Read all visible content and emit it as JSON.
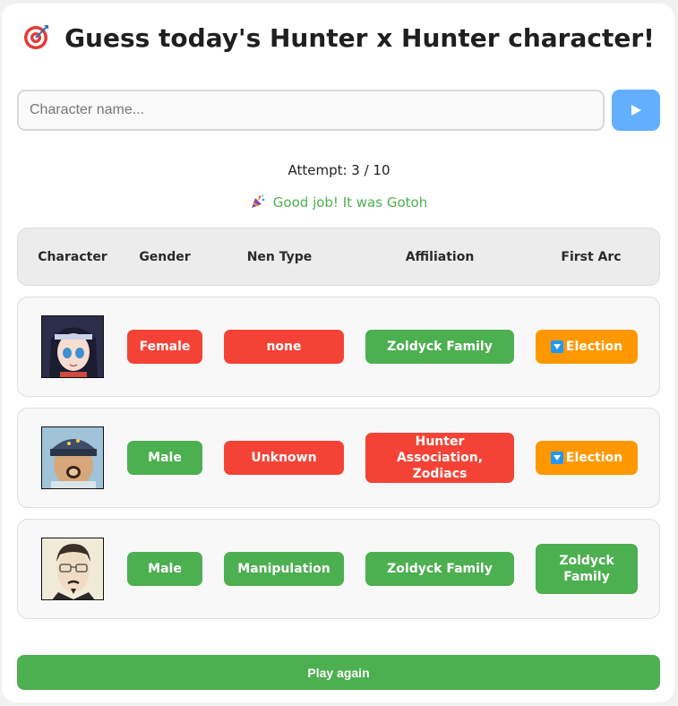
{
  "header": {
    "title": "Guess today's Hunter x Hunter character!",
    "icon": "target-icon"
  },
  "search": {
    "placeholder": "Character name...",
    "value": "",
    "submit_icon": "play-triangle-icon"
  },
  "status": {
    "attempt": "Attempt: 3 / 10",
    "result": "Good job! It was Gotoh",
    "result_icon": "party-popper-icon",
    "result_color": "#4caf50"
  },
  "table": {
    "columns": [
      "Character",
      "Gender",
      "Nen Type",
      "Affiliation",
      "First Arc"
    ],
    "rows": [
      {
        "character": "Alluka-style girl portrait",
        "gender": {
          "text": "Female",
          "status": "wrong"
        },
        "nen_type": {
          "text": "none",
          "status": "wrong"
        },
        "affiliation": {
          "text": "Zoldyck Family",
          "status": "correct"
        },
        "first_arc": {
          "text": "Election",
          "status": "partial",
          "hint": "lower"
        }
      },
      {
        "character": "Bald man with hat portrait",
        "gender": {
          "text": "Male",
          "status": "correct"
        },
        "nen_type": {
          "text": "Unknown",
          "status": "wrong"
        },
        "affiliation": {
          "text": "Hunter Association, Zodiacs",
          "status": "wrong"
        },
        "first_arc": {
          "text": "Election",
          "status": "partial",
          "hint": "lower"
        }
      },
      {
        "character": "Gotoh portrait",
        "gender": {
          "text": "Male",
          "status": "correct"
        },
        "nen_type": {
          "text": "Manipulation",
          "status": "correct"
        },
        "affiliation": {
          "text": "Zoldyck Family",
          "status": "correct"
        },
        "first_arc": {
          "text": "Zoldyck Family",
          "status": "correct"
        }
      }
    ]
  },
  "colors": {
    "correct": "#4caf50",
    "wrong": "#f44336",
    "partial": "#ff9800",
    "submit": "#63aeff"
  },
  "footer": {
    "play_again": "Play again"
  }
}
